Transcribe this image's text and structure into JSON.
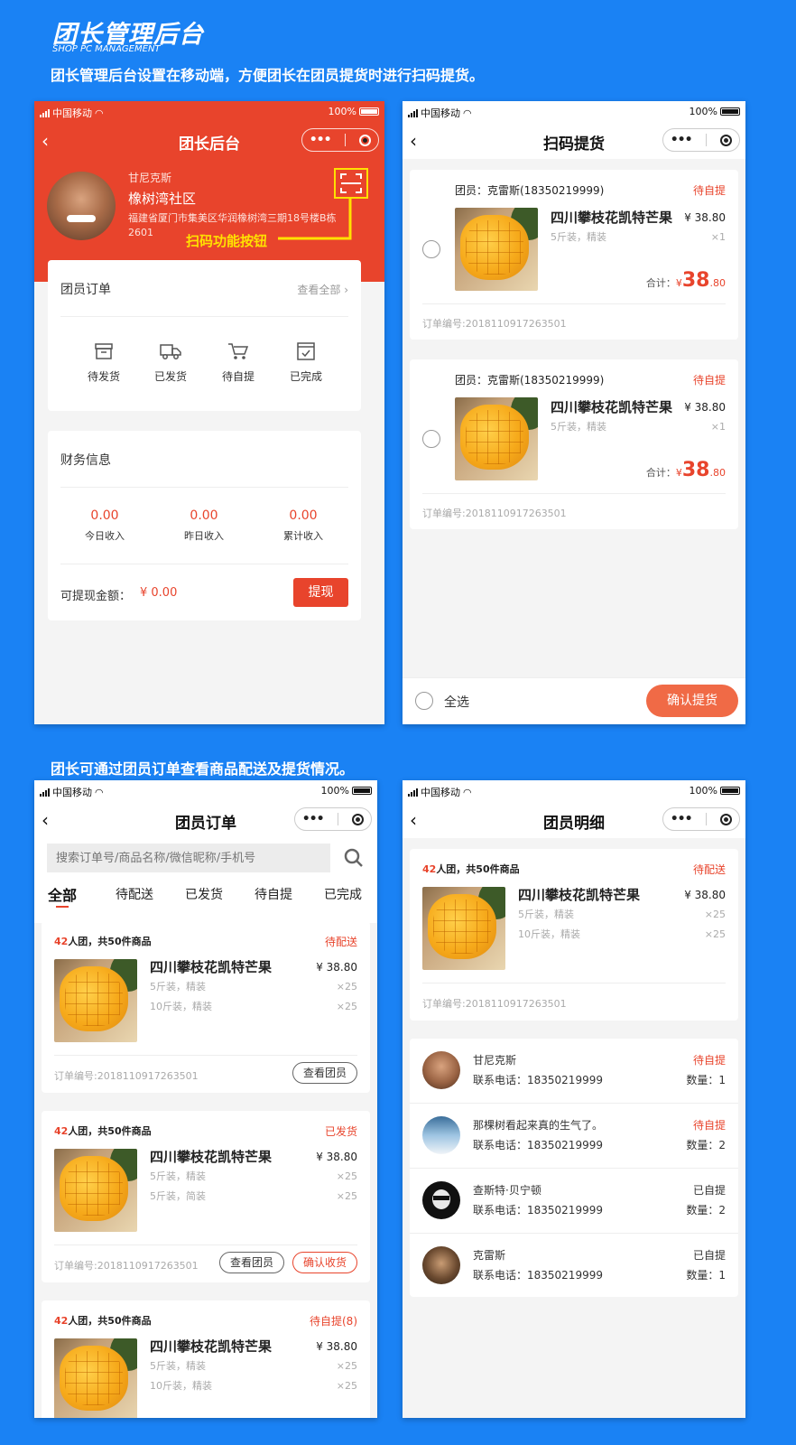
{
  "header": {
    "title": "团长管理后台",
    "subtitle": "SHOP PC MANAGEMENT",
    "desc": "团长管理后台设置在移动端，方便团长在团员提货时进行扫码提货。",
    "desc2": "团长可通过团员订单查看商品配送及提货情况。"
  },
  "status_bar": {
    "carrier": "中国移动",
    "battery": "100%"
  },
  "colors": {
    "accent": "#e8442c",
    "background": "#1a82f4",
    "annotation": "#ffe100"
  },
  "screen1": {
    "title": "团长后台",
    "user": {
      "name": "甘尼克斯",
      "community": "橡树湾社区",
      "address": "福建省厦门市集美区华润橡树湾三期18号楼B栋2601"
    },
    "scan_annotation": "扫码功能按钮",
    "orders": {
      "title": "团员订单",
      "view_all": "查看全部",
      "items": [
        {
          "label": "待发货",
          "icon": "box-icon"
        },
        {
          "label": "已发货",
          "icon": "truck-icon"
        },
        {
          "label": "待自提",
          "icon": "cart-icon"
        },
        {
          "label": "已完成",
          "icon": "check-icon"
        }
      ]
    },
    "finance": {
      "title": "财务信息",
      "stats": [
        {
          "value": "0.00",
          "label": "今日收入"
        },
        {
          "value": "0.00",
          "label": "昨日收入"
        },
        {
          "value": "0.00",
          "label": "累计收入"
        }
      ],
      "withdrawable_label": "可提现金额：",
      "withdrawable_value": "¥ 0.00",
      "withdraw_button": "提现"
    }
  },
  "screen2": {
    "title": "扫码提货",
    "orders": [
      {
        "member": "团员：克雷斯(18350219999)",
        "status": "待自提",
        "product": "四川攀枝花凯特芒果",
        "price": "¥ 38.80",
        "spec": "5斤装，精装",
        "qty": "×1",
        "total_label": "合计：",
        "total_currency": "¥",
        "total_int": "38",
        "total_dec": ".80",
        "order_no": "订单编号:2018110917263501"
      },
      {
        "member": "团员：克雷斯(18350219999)",
        "status": "待自提",
        "product": "四川攀枝花凯特芒果",
        "price": "¥ 38.80",
        "spec": "5斤装，精装",
        "qty": "×1",
        "total_label": "合计：",
        "total_currency": "¥",
        "total_int": "38",
        "total_dec": ".80",
        "order_no": "订单编号:2018110917263501"
      }
    ],
    "select_all": "全选",
    "confirm_button": "确认提货"
  },
  "screen3": {
    "title": "团员订单",
    "search_placeholder": "搜索订单号/商品名称/微信昵称/手机号",
    "tabs": [
      "全部",
      "待配送",
      "已发货",
      "待自提",
      "已完成"
    ],
    "orders": [
      {
        "count": "42",
        "summary": "人团，共50件商品",
        "status": "待配送",
        "product": "四川攀枝花凯特芒果",
        "price": "¥ 38.80",
        "spec1": "5斤装，精装",
        "qty1": "×25",
        "spec2": "10斤装，精装",
        "qty2": "×25",
        "order_no": "订单编号:2018110917263501",
        "buttons": [
          "查看团员"
        ]
      },
      {
        "count": "42",
        "summary": "人团，共50件商品",
        "status": "已发货",
        "product": "四川攀枝花凯特芒果",
        "price": "¥ 38.80",
        "spec1": "5斤装，精装",
        "qty1": "×25",
        "spec2": "5斤装，简装",
        "qty2": "×25",
        "order_no": "订单编号:2018110917263501",
        "buttons": [
          "查看团员",
          "确认收货"
        ]
      },
      {
        "count": "42",
        "summary": "人团，共50件商品",
        "status": "待自提(8)",
        "product": "四川攀枝花凯特芒果",
        "price": "¥ 38.80",
        "spec1": "5斤装，精装",
        "qty1": "×25",
        "spec2": "10斤装，精装",
        "qty2": "×25"
      }
    ]
  },
  "screen4": {
    "title": "团员明细",
    "order": {
      "count": "42",
      "summary": "人团，共50件商品",
      "status": "待配送",
      "product": "四川攀枝花凯特芒果",
      "price": "¥ 38.80",
      "spec1": "5斤装，精装",
      "qty1": "×25",
      "spec2": "10斤装，精装",
      "qty2": "×25",
      "order_no": "订单编号:2018110917263501"
    },
    "members": [
      {
        "name": "甘尼克斯",
        "phone": "联系电话：18350219999",
        "status": "待自提",
        "status_color": "#e8442c",
        "qty": "数量：1"
      },
      {
        "name": "那棵树看起来真的生气了。",
        "phone": "联系电话：18350219999",
        "status": "待自提",
        "status_color": "#e8442c",
        "qty": "数量：2"
      },
      {
        "name": "查斯特·贝宁顿",
        "phone": "联系电话：18350219999",
        "status": "已自提",
        "status_color": "#333333",
        "qty": "数量：2"
      },
      {
        "name": "克雷斯",
        "phone": "联系电话：18350219999",
        "status": "已自提",
        "status_color": "#333333",
        "qty": "数量：1"
      }
    ]
  }
}
